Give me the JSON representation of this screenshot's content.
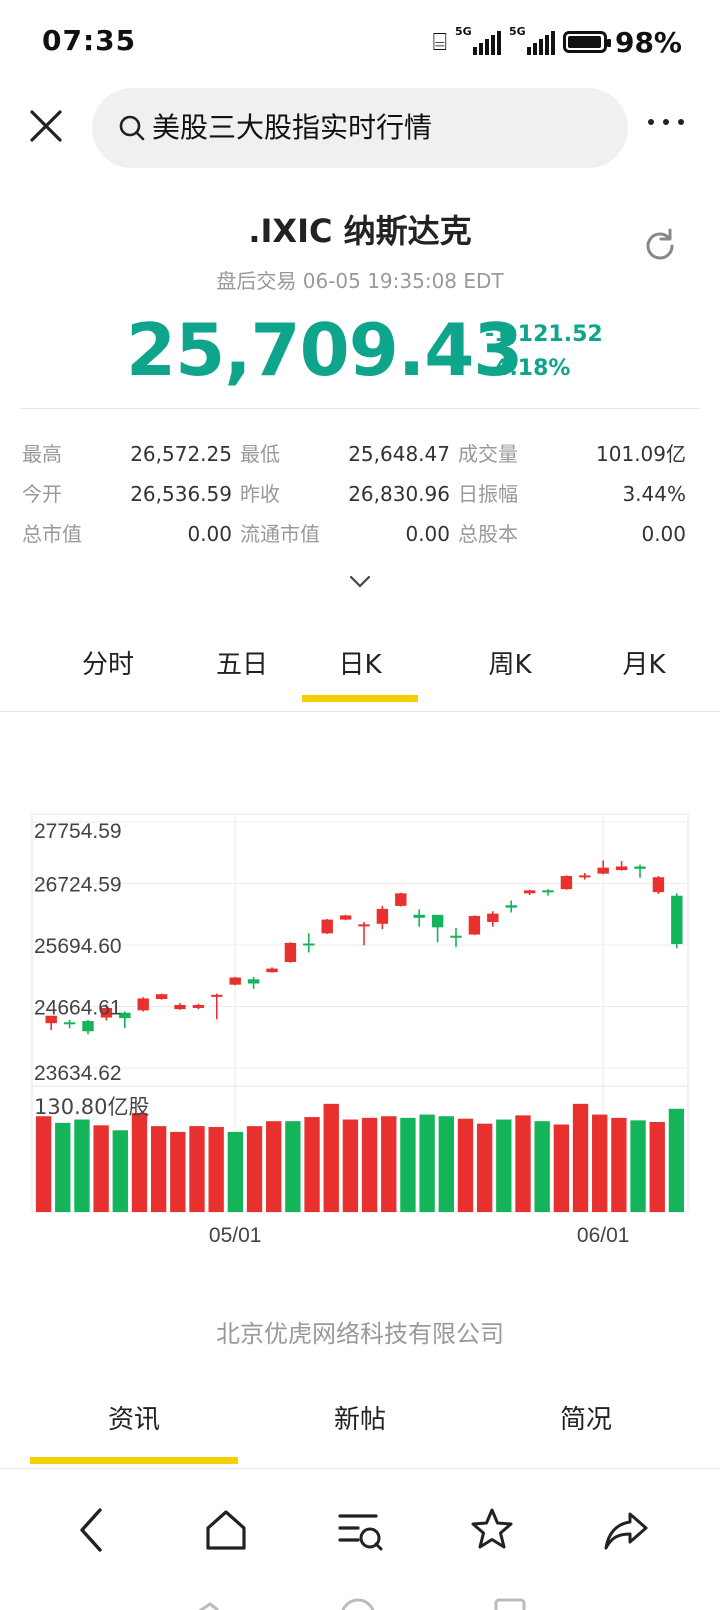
{
  "status_bar": {
    "time": "07:35",
    "battery": "98%",
    "battery_level": 0.98,
    "net1": "5G",
    "net2": "5G"
  },
  "search": {
    "query": "美股三大股指实时行情"
  },
  "quote": {
    "title": ".IXIC 纳斯达克",
    "subtitle": "盘后交易 06-05 19:35:08 EDT",
    "price": "25,709.43",
    "change": "-1,121.52",
    "change_pct": "-4.18%"
  },
  "stats": [
    [
      {
        "label": "最高",
        "value": "26,572.25"
      },
      {
        "label": "最低",
        "value": "25,648.47"
      },
      {
        "label": "成交量",
        "value": "101.09亿"
      }
    ],
    [
      {
        "label": "今开",
        "value": "26,536.59"
      },
      {
        "label": "昨收",
        "value": "26,830.96"
      },
      {
        "label": "日振幅",
        "value": "3.44%"
      }
    ],
    [
      {
        "label": "总市值",
        "value": "0.00"
      },
      {
        "label": "流通市值",
        "value": "0.00"
      },
      {
        "label": "总股本",
        "value": "0.00"
      }
    ]
  ],
  "chart_tabs": [
    "分时",
    "五日",
    "日K",
    "周K",
    "月K"
  ],
  "active_chart_tab": 2,
  "chart_data": {
    "type": "candlestick",
    "y_ticks": [
      "27754.59",
      "26724.59",
      "25694.60",
      "24664.61",
      "23634.62"
    ],
    "ylim": [
      23634.62,
      27754.59
    ],
    "volume_label": "130.80亿股",
    "volume_max": 130.8,
    "x_labels": [
      {
        "label": "05/01",
        "index": 10
      },
      {
        "label": "06/01",
        "index": 30
      }
    ],
    "colors": {
      "up": "#e8312f",
      "down": "#14b45a"
    },
    "candles": [
      {
        "o": 24385,
        "h": 24440,
        "l": 24270,
        "c": 24510,
        "up": true
      },
      {
        "o": 24400,
        "h": 24440,
        "l": 24300,
        "c": 24400,
        "up": false
      },
      {
        "o": 24420,
        "h": 24440,
        "l": 24200,
        "c": 24250,
        "up": false
      },
      {
        "o": 24480,
        "h": 24700,
        "l": 24430,
        "c": 24640,
        "up": true
      },
      {
        "o": 24560,
        "h": 24580,
        "l": 24300,
        "c": 24470,
        "up": false
      },
      {
        "o": 24600,
        "h": 24820,
        "l": 24580,
        "c": 24800,
        "up": true
      },
      {
        "o": 24790,
        "h": 24880,
        "l": 24780,
        "c": 24870,
        "up": true
      },
      {
        "o": 24620,
        "h": 24720,
        "l": 24610,
        "c": 24690,
        "up": true
      },
      {
        "o": 24640,
        "h": 24710,
        "l": 24620,
        "c": 24690,
        "up": true
      },
      {
        "o": 24830,
        "h": 24880,
        "l": 24450,
        "c": 24860,
        "up": true
      },
      {
        "o": 25030,
        "h": 25160,
        "l": 25020,
        "c": 25150,
        "up": true
      },
      {
        "o": 25120,
        "h": 25160,
        "l": 24960,
        "c": 25050,
        "up": false
      },
      {
        "o": 25240,
        "h": 25320,
        "l": 25230,
        "c": 25300,
        "up": true
      },
      {
        "o": 25410,
        "h": 25740,
        "l": 25400,
        "c": 25730,
        "up": true
      },
      {
        "o": 25720,
        "h": 25890,
        "l": 25570,
        "c": 25690,
        "up": false
      },
      {
        "o": 25890,
        "h": 26130,
        "l": 25880,
        "c": 26120,
        "up": true
      },
      {
        "o": 26120,
        "h": 26200,
        "l": 26110,
        "c": 26190,
        "up": true
      },
      {
        "o": 26020,
        "h": 26080,
        "l": 25690,
        "c": 26040,
        "up": true
      },
      {
        "o": 26050,
        "h": 26350,
        "l": 25960,
        "c": 26300,
        "up": true
      },
      {
        "o": 26350,
        "h": 26570,
        "l": 26340,
        "c": 26560,
        "up": true
      },
      {
        "o": 26200,
        "h": 26290,
        "l": 26000,
        "c": 26150,
        "up": false
      },
      {
        "o": 26200,
        "h": 26200,
        "l": 25740,
        "c": 25990,
        "up": false
      },
      {
        "o": 25850,
        "h": 25980,
        "l": 25660,
        "c": 25820,
        "up": false
      },
      {
        "o": 25870,
        "h": 26190,
        "l": 25860,
        "c": 26180,
        "up": true
      },
      {
        "o": 26080,
        "h": 26260,
        "l": 26000,
        "c": 26220,
        "up": true
      },
      {
        "o": 26360,
        "h": 26440,
        "l": 26240,
        "c": 26320,
        "up": false
      },
      {
        "o": 26560,
        "h": 26620,
        "l": 26530,
        "c": 26610,
        "up": true
      },
      {
        "o": 26610,
        "h": 26630,
        "l": 26520,
        "c": 26590,
        "up": false
      },
      {
        "o": 26630,
        "h": 26860,
        "l": 26620,
        "c": 26850,
        "up": true
      },
      {
        "o": 26840,
        "h": 26900,
        "l": 26790,
        "c": 26860,
        "up": true
      },
      {
        "o": 26890,
        "h": 27110,
        "l": 26880,
        "c": 26990,
        "up": true
      },
      {
        "o": 26950,
        "h": 27100,
        "l": 26940,
        "c": 27010,
        "up": true
      },
      {
        "o": 27010,
        "h": 27040,
        "l": 26820,
        "c": 26970,
        "up": false
      },
      {
        "o": 26580,
        "h": 26850,
        "l": 26550,
        "c": 26830,
        "up": true
      },
      {
        "o": 26520,
        "h": 26560,
        "l": 25640,
        "c": 25710,
        "up": false
      }
    ],
    "volumes": [
      {
        "v": 116,
        "up": true
      },
      {
        "v": 108,
        "up": false
      },
      {
        "v": 112,
        "up": false
      },
      {
        "v": 105,
        "up": true
      },
      {
        "v": 99,
        "up": false
      },
      {
        "v": 120,
        "up": true
      },
      {
        "v": 104,
        "up": true
      },
      {
        "v": 97,
        "up": true
      },
      {
        "v": 104,
        "up": true
      },
      {
        "v": 103,
        "up": true
      },
      {
        "v": 97,
        "up": false
      },
      {
        "v": 104,
        "up": true
      },
      {
        "v": 110,
        "up": true
      },
      {
        "v": 110,
        "up": false
      },
      {
        "v": 115,
        "up": true
      },
      {
        "v": 131,
        "up": true
      },
      {
        "v": 112,
        "up": true
      },
      {
        "v": 114,
        "up": true
      },
      {
        "v": 116,
        "up": true
      },
      {
        "v": 114,
        "up": false
      },
      {
        "v": 118,
        "up": false
      },
      {
        "v": 116,
        "up": false
      },
      {
        "v": 113,
        "up": true
      },
      {
        "v": 107,
        "up": true
      },
      {
        "v": 112,
        "up": false
      },
      {
        "v": 117,
        "up": true
      },
      {
        "v": 110,
        "up": false
      },
      {
        "v": 106,
        "up": true
      },
      {
        "v": 131,
        "up": true
      },
      {
        "v": 118,
        "up": true
      },
      {
        "v": 114,
        "up": true
      },
      {
        "v": 111,
        "up": false
      },
      {
        "v": 109,
        "up": true
      },
      {
        "v": 125,
        "up": false
      }
    ]
  },
  "company": "北京优虎网络科技有限公司",
  "bottom_tabs": [
    "资讯",
    "新帖",
    "简况"
  ],
  "active_bottom_tab": 0,
  "nav_icons": [
    "back-icon",
    "home-icon",
    "list-search-icon",
    "star-icon",
    "share-icon"
  ]
}
